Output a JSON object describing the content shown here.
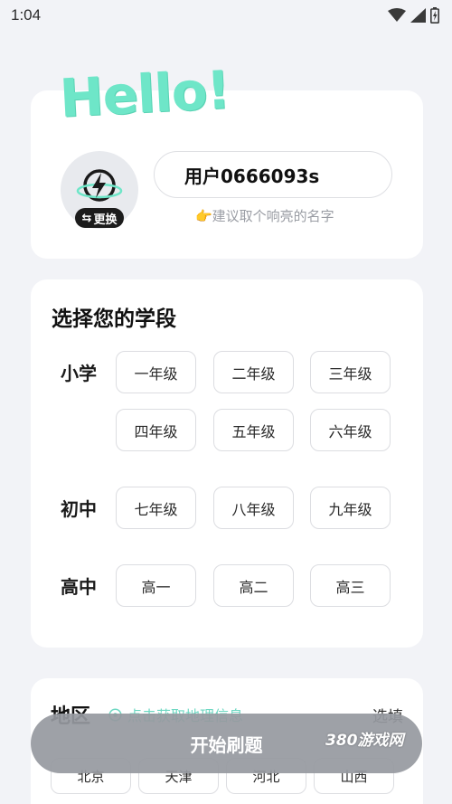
{
  "status_bar": {
    "time": "1:04",
    "icons": [
      "wifi-icon",
      "signal-icon",
      "battery-icon"
    ]
  },
  "greeting": "Hello!",
  "profile": {
    "change_avatar_label": "更换",
    "username": "用户0666093s",
    "hint": "👉建议取个响亮的名字"
  },
  "grade_section": {
    "title": "选择您的学段",
    "levels": [
      {
        "label": "小学",
        "grades": [
          "一年级",
          "二年级",
          "三年级",
          "四年级",
          "五年级",
          "六年级"
        ]
      },
      {
        "label": "初中",
        "grades": [
          "七年级",
          "八年级",
          "九年级"
        ]
      },
      {
        "label": "高中",
        "grades": [
          "高一",
          "高二",
          "高三"
        ]
      }
    ]
  },
  "region_section": {
    "title": "地区",
    "locate_text": "点击获取地理信息",
    "optional_label": "选填",
    "regions": [
      "北京",
      "天津",
      "河北",
      "山西"
    ]
  },
  "start_button": "开始刷题",
  "watermark": "380游戏网",
  "colors": {
    "accent": "#6ee6c8",
    "button_gray": "#96999f",
    "background": "#f2f3f7"
  }
}
